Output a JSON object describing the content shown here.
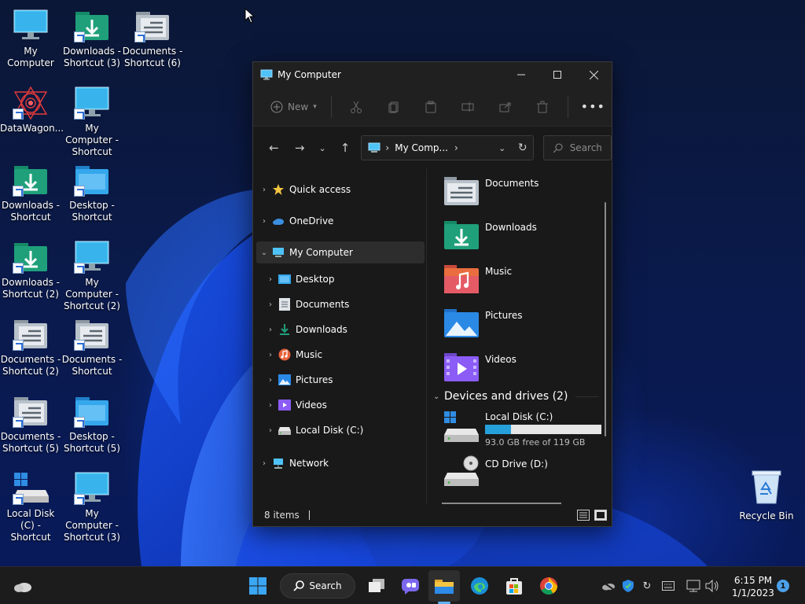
{
  "desktop": {
    "icons": [
      {
        "label": "My Computer",
        "type": "computer",
        "shortcut": false
      },
      {
        "label": "Downloads - Shortcut (3)",
        "type": "downloads",
        "shortcut": true
      },
      {
        "label": "Documents - Shortcut (6)",
        "type": "documents",
        "shortcut": true
      },
      {
        "label": "DataWagon...",
        "type": "datawagon",
        "shortcut": true
      },
      {
        "label": "My Computer - Shortcut",
        "type": "computer",
        "shortcut": true
      },
      {
        "label": "Downloads - Shortcut",
        "type": "downloads",
        "shortcut": true
      },
      {
        "label": "Desktop - Shortcut",
        "type": "desktop",
        "shortcut": true
      },
      {
        "label": "Downloads - Shortcut (2)",
        "type": "downloads",
        "shortcut": true
      },
      {
        "label": "My Computer - Shortcut (2)",
        "type": "computer",
        "shortcut": true
      },
      {
        "label": "Documents - Shortcut (2)",
        "type": "documents",
        "shortcut": true
      },
      {
        "label": "Documents - Shortcut",
        "type": "documents",
        "shortcut": true
      },
      {
        "label": "Documents - Shortcut (5)",
        "type": "documents",
        "shortcut": true
      },
      {
        "label": "Desktop - Shortcut (5)",
        "type": "desktop",
        "shortcut": true
      },
      {
        "label": "Local Disk (C) - Shortcut",
        "type": "disk",
        "shortcut": true
      },
      {
        "label": "My Computer - Shortcut (3)",
        "type": "computer",
        "shortcut": true
      }
    ],
    "recycle_bin": "Recycle Bin"
  },
  "window": {
    "title": "My Computer",
    "toolbar": {
      "new_label": "New"
    },
    "address": {
      "path": "My Comp...",
      "search_placeholder": "Search"
    },
    "nav_pane": {
      "quick_access": "Quick access",
      "onedrive": "OneDrive",
      "my_computer": "My Computer",
      "children": [
        "Desktop",
        "Documents",
        "Downloads",
        "Music",
        "Pictures",
        "Videos",
        "Local Disk (C:)"
      ],
      "network": "Network"
    },
    "content": {
      "folders": [
        "Documents",
        "Downloads",
        "Music",
        "Pictures",
        "Videos"
      ],
      "devices_header": "Devices and drives (2)",
      "local_disk": {
        "name": "Local Disk (C:)",
        "free": "93.0 GB free of 119 GB",
        "used_fraction": 0.22
      },
      "cd_drive": {
        "name": "CD Drive (D:)"
      }
    },
    "status": {
      "items": "8 items"
    }
  },
  "taskbar": {
    "search_label": "Search",
    "time": "6:15 PM",
    "date": "1/1/2023",
    "notifications": "1"
  },
  "colors": {
    "accent": "#26a0da",
    "folder_green": "#1fa07a",
    "folder_yellow": "#f4c542"
  }
}
